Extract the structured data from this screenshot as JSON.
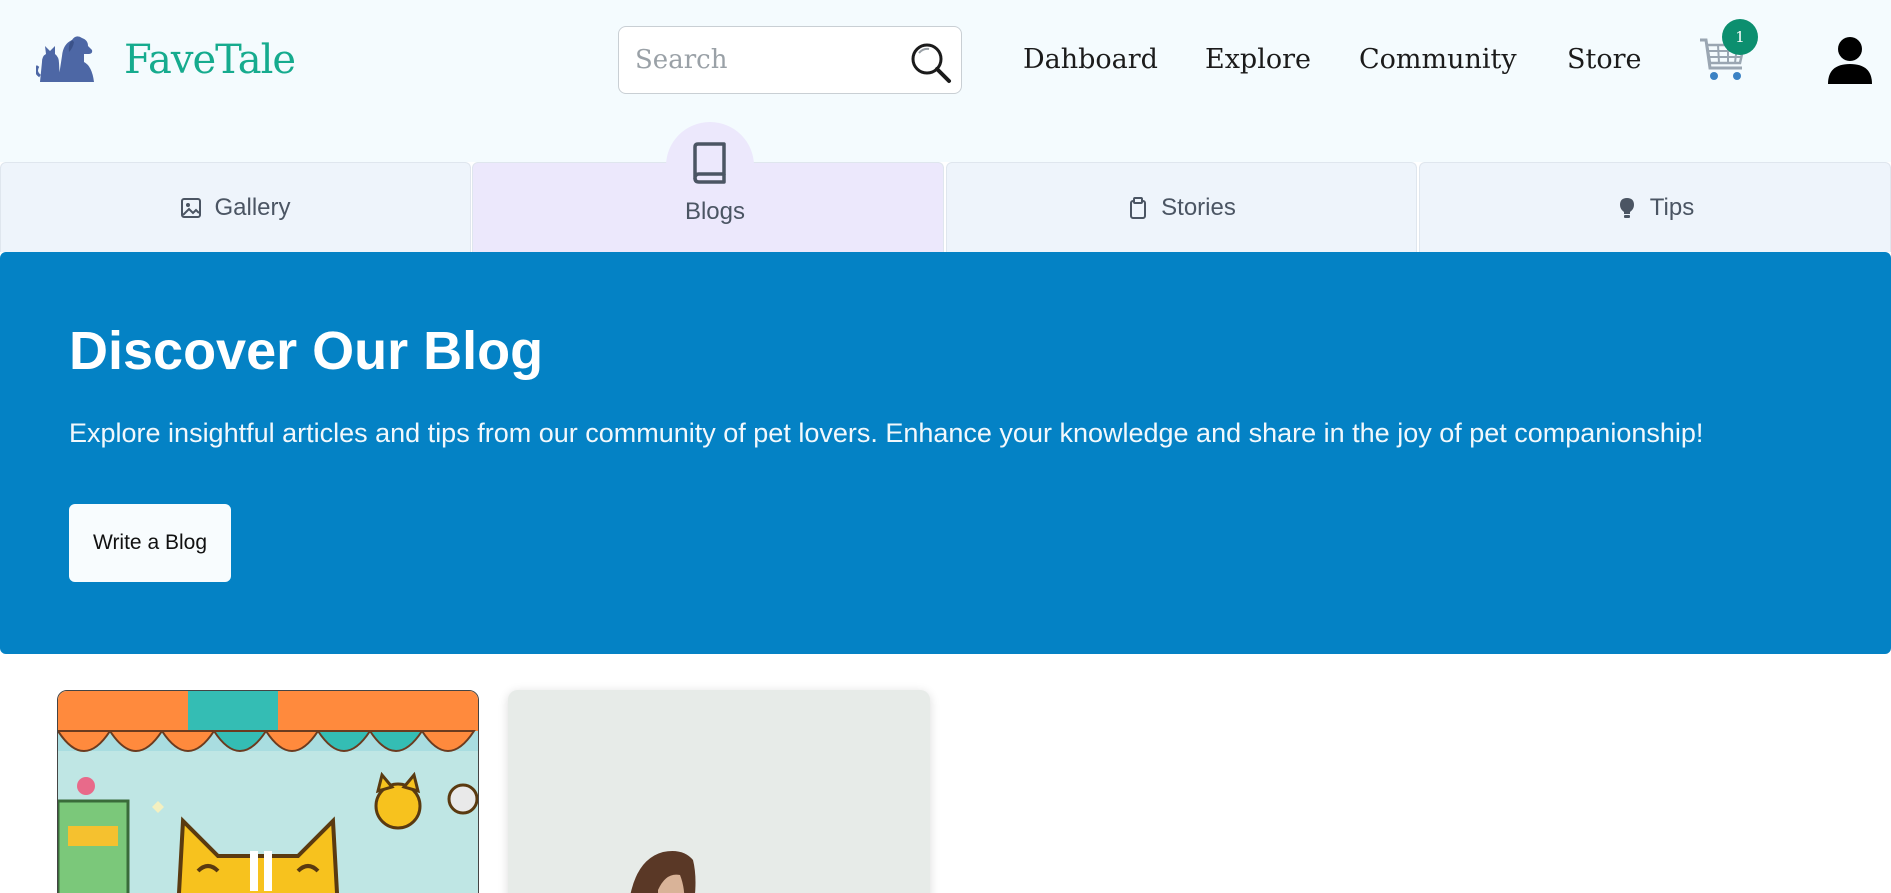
{
  "brand": {
    "name": "FaveTale",
    "logo_icon": "pets-logo-icon"
  },
  "search": {
    "placeholder": "Search",
    "icon": "search-icon"
  },
  "nav": {
    "items": [
      {
        "label": "Dahboard"
      },
      {
        "label": "Explore"
      },
      {
        "label": "Community"
      },
      {
        "label": "Store"
      }
    ],
    "cart_icon": "cart-icon",
    "cart_count": "1",
    "user_icon": "user-icon"
  },
  "tabs": [
    {
      "label": "Gallery",
      "icon": "image-icon",
      "active": false
    },
    {
      "label": "Blogs",
      "icon": "book-icon",
      "active": true
    },
    {
      "label": "Stories",
      "icon": "clipboard-icon",
      "active": false
    },
    {
      "label": "Tips",
      "icon": "lightbulb-icon",
      "active": false
    }
  ],
  "hero": {
    "title": "Discover Our Blog",
    "subtitle": "Explore insightful articles and tips from our community of pet lovers. Enhance your knowledge and share in the joy of pet companionship!",
    "button_label": "Write a Blog"
  },
  "colors": {
    "brand": "#16ab8e",
    "hero_bg": "#0482c5",
    "header_bg": "#f4fbfe",
    "tab_bg": "#eef4fb",
    "tab_active_bg": "#ece8fc",
    "badge": "#0c8f6f"
  },
  "cards": [
    {
      "image": "cartoon-cat-pet-shop-image"
    },
    {
      "image": "person-photo-image"
    }
  ]
}
